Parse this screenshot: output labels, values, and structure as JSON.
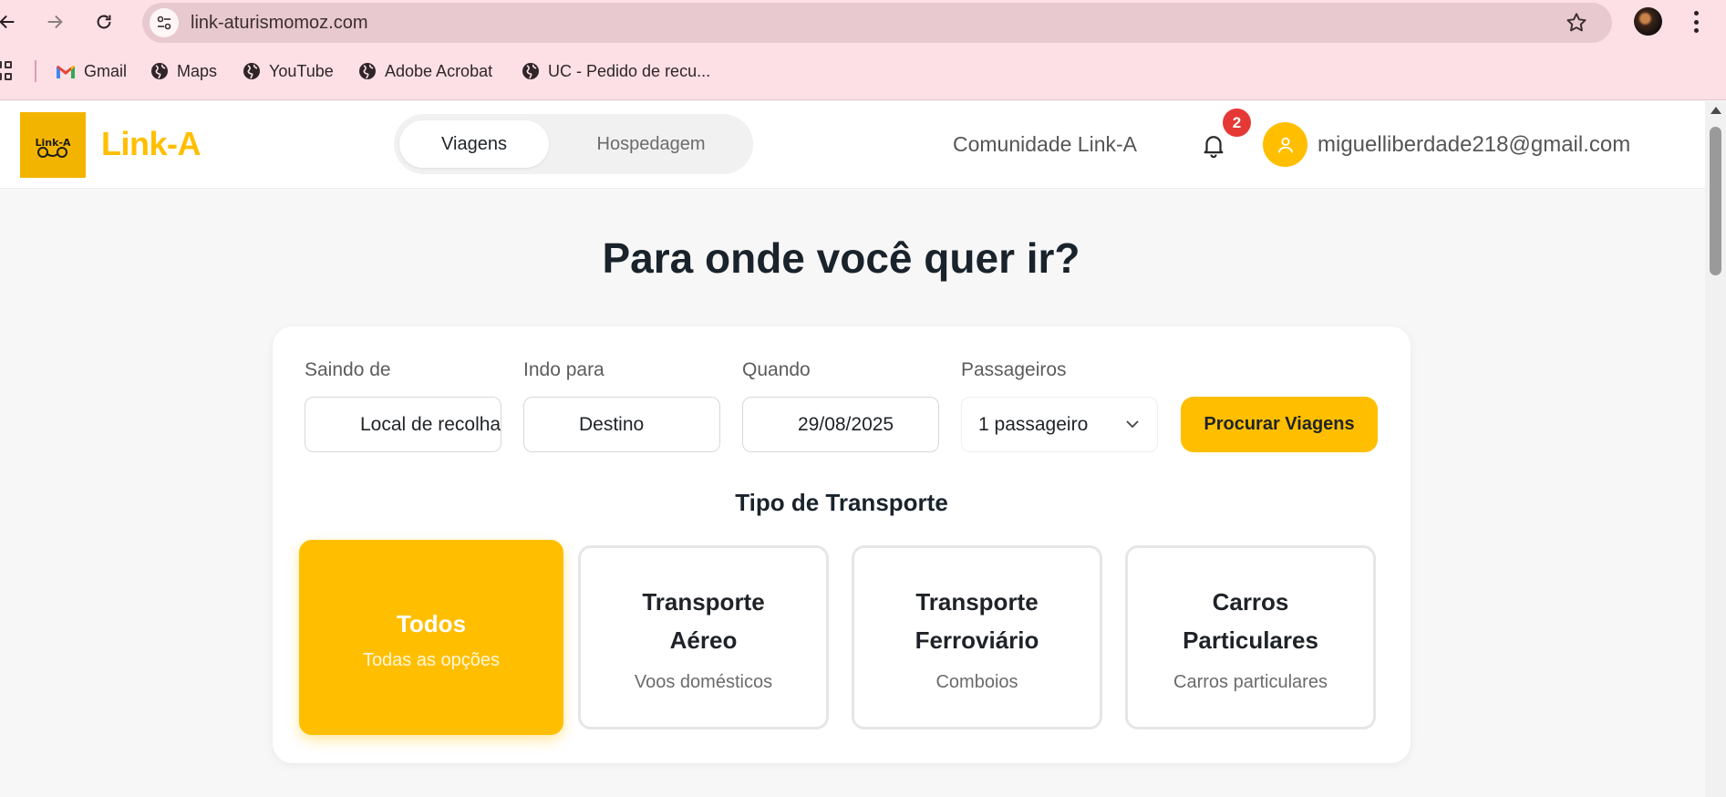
{
  "browser": {
    "url": "link-aturismomoz.com",
    "bookmarks": [
      {
        "label": "Gmail",
        "icon": "gmail-icon"
      },
      {
        "label": "Maps",
        "icon": "globe-icon"
      },
      {
        "label": "YouTube",
        "icon": "globe-icon"
      },
      {
        "label": "Adobe Acrobat",
        "icon": "globe-icon"
      },
      {
        "label": "UC - Pedido de recu...",
        "icon": "globe-icon"
      }
    ]
  },
  "header": {
    "logo_text": "Link-A",
    "brand": "Link-A",
    "brand_color": "#ffbf00",
    "tabs": [
      {
        "label": "Viagens",
        "active": true
      },
      {
        "label": "Hospedagem",
        "active": false
      }
    ],
    "community": "Comunidade Link-A",
    "notifications_count": "2",
    "user_email": "miguelliberdade218@gmail.com"
  },
  "main": {
    "title": "Para onde você quer ir?",
    "search": {
      "from_label": "Saindo de",
      "from_value": "Local de recolha",
      "to_label": "Indo para",
      "to_value": "Destino",
      "date_label": "Quando",
      "date_value": "29/08/2025",
      "passengers_label": "Passageiros",
      "passengers_value": "1 passageiro",
      "button": "Procurar Viagens"
    },
    "transport_title": "Tipo de Transporte",
    "transport_options": [
      {
        "title": "Todos",
        "subtitle": "Todas as opções",
        "selected": true
      },
      {
        "title": "Transporte Aéreo",
        "subtitle": "Voos domésticos",
        "selected": false
      },
      {
        "title": "Transporte Ferroviário",
        "subtitle": "Comboios",
        "selected": false
      },
      {
        "title": "Carros Particulares",
        "subtitle": "Carros particulares",
        "selected": false
      }
    ]
  }
}
